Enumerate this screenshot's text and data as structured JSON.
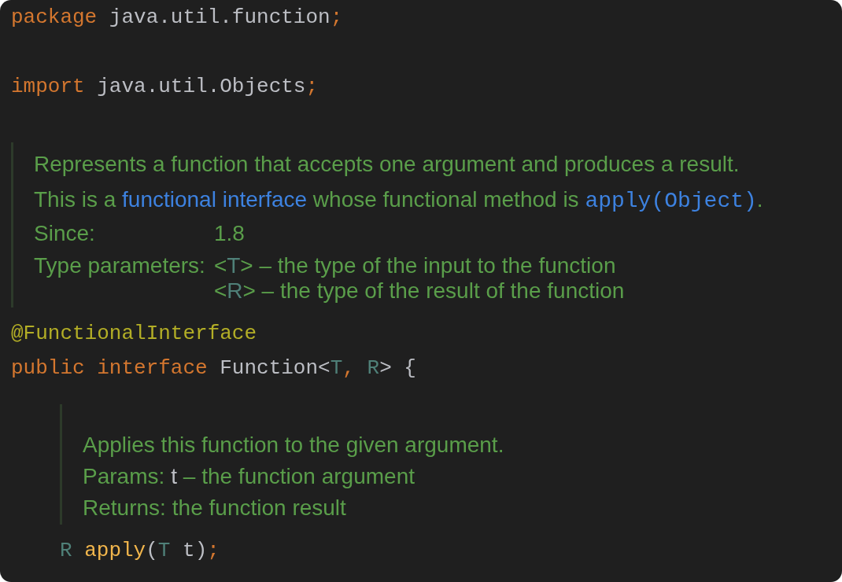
{
  "editor": {
    "lines": [
      {
        "kind": "code",
        "tokens": [
          {
            "text": "package",
            "kind": "keyword"
          },
          {
            "text": " java.util.function",
            "kind": "plain"
          },
          {
            "text": ";",
            "kind": "punct"
          }
        ]
      },
      {
        "kind": "blank"
      },
      {
        "kind": "code",
        "tokens": [
          {
            "text": "import",
            "kind": "keyword"
          },
          {
            "text": " java.util.Objects",
            "kind": "plain"
          },
          {
            "text": ";",
            "kind": "punct"
          }
        ]
      },
      {
        "kind": "doc",
        "paragraphs": [
          [
            {
              "text": "Represents a function that accepts one argument and produces a result.",
              "kind": "text"
            }
          ],
          [
            {
              "text": "This is a ",
              "kind": "text"
            },
            {
              "text": "functional interface",
              "kind": "link"
            },
            {
              "text": " whose functional method is ",
              "kind": "text"
            },
            {
              "text": "apply(Object)",
              "kind": "codelink"
            },
            {
              "text": ".",
              "kind": "text"
            }
          ]
        ],
        "fields": [
          {
            "label": "Since:",
            "values": [
              [
                {
                  "text": "1.8",
                  "kind": "text"
                }
              ]
            ]
          },
          {
            "label": "Type parameters:",
            "values": [
              [
                {
                  "text": "<",
                  "kind": "text"
                },
                {
                  "text": "T",
                  "kind": "typeparam"
                },
                {
                  "text": "> – the type of the input to the function",
                  "kind": "text"
                }
              ],
              [
                {
                  "text": "<",
                  "kind": "text"
                },
                {
                  "text": "R",
                  "kind": "typeparam"
                },
                {
                  "text": "> – the type of the result of the function",
                  "kind": "text"
                }
              ]
            ]
          }
        ]
      },
      {
        "kind": "code",
        "tokens": [
          {
            "text": "@FunctionalInterface",
            "kind": "annotation"
          }
        ]
      },
      {
        "kind": "code",
        "tokens": [
          {
            "text": "public",
            "kind": "keyword"
          },
          {
            "text": " interface",
            "kind": "keyword"
          },
          {
            "text": " Function<",
            "kind": "plain"
          },
          {
            "text": "T",
            "kind": "typeparam"
          },
          {
            "text": ",",
            "kind": "punct"
          },
          {
            "text": " R",
            "kind": "typeparam"
          },
          {
            "text": "> {",
            "kind": "plain"
          }
        ],
        "children": [
          {
            "kind": "docinline",
            "paragraphs": [
              [
                {
                  "text": "Applies this function to the given argument.",
                  "kind": "text"
                }
              ]
            ],
            "fields": [
              {
                "label": "Params:",
                "values": [
                  [
                    {
                      "text": "t",
                      "kind": "param"
                    },
                    {
                      "text": " – the function argument",
                      "kind": "text"
                    }
                  ]
                ]
              },
              {
                "label": "Returns:",
                "values": [
                  [
                    {
                      "text": "the function result",
                      "kind": "text"
                    }
                  ]
                ]
              }
            ]
          },
          {
            "kind": "code",
            "tokens": [
              {
                "text": "R",
                "kind": "typeparam"
              },
              {
                "text": " apply",
                "kind": "method"
              },
              {
                "text": "(",
                "kind": "plain"
              },
              {
                "text": "T",
                "kind": "typeparam"
              },
              {
                "text": " t)",
                "kind": "plain"
              },
              {
                "text": ";",
                "kind": "punct"
              }
            ]
          }
        ]
      }
    ]
  }
}
